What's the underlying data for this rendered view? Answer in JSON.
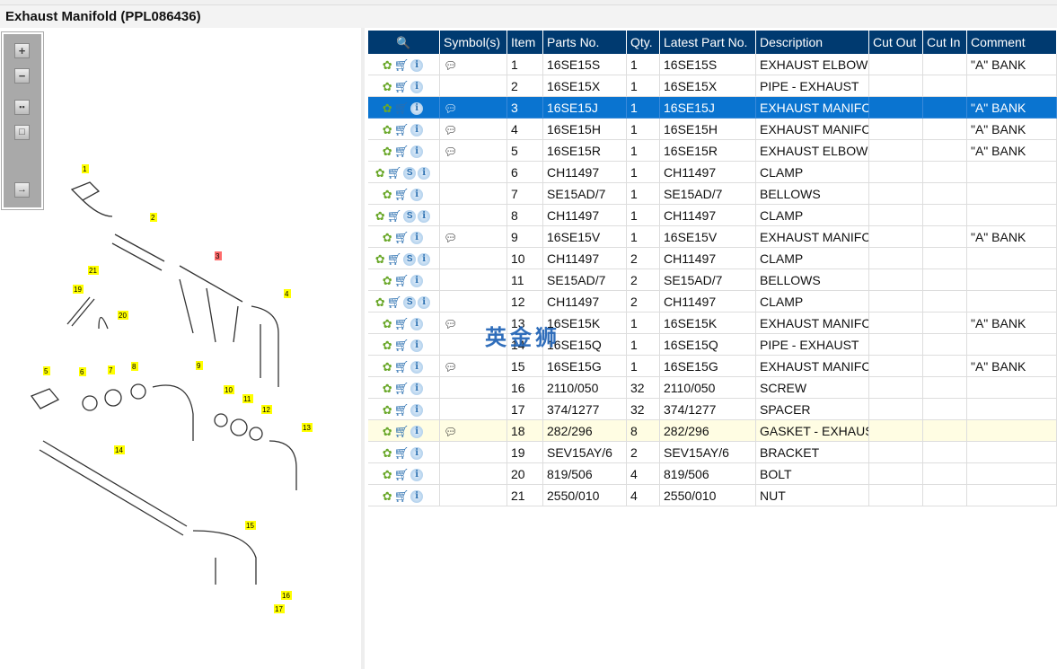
{
  "title": "Exhaust Manifold (PPL086436)",
  "toolbar": [
    "zoom-in",
    "zoom-out",
    "fit-all",
    "fit-window",
    "expand-panel"
  ],
  "columns": [
    "",
    "Symbol(s)",
    "Item",
    "Parts No.",
    "Qty.",
    "Latest Part No.",
    "Description",
    "Cut Out",
    "Cut In",
    "Comment"
  ],
  "rows": [
    {
      "item": "1",
      "part": "16SE15S",
      "qty": "1",
      "latest": "16SE15S",
      "desc": "EXHAUST ELBOW",
      "comment": "\"A\" BANK",
      "sym": true,
      "s": false
    },
    {
      "item": "2",
      "part": "16SE15X",
      "qty": "1",
      "latest": "16SE15X",
      "desc": "PIPE - EXHAUST",
      "comment": "",
      "sym": false,
      "s": false
    },
    {
      "item": "3",
      "part": "16SE15J",
      "qty": "1",
      "latest": "16SE15J",
      "desc": "EXHAUST MANIFC",
      "comment": "\"A\" BANK",
      "sym": true,
      "s": false,
      "selected": true
    },
    {
      "item": "4",
      "part": "16SE15H",
      "qty": "1",
      "latest": "16SE15H",
      "desc": "EXHAUST MANIFC",
      "comment": "\"A\" BANK",
      "sym": true,
      "s": false
    },
    {
      "item": "5",
      "part": "16SE15R",
      "qty": "1",
      "latest": "16SE15R",
      "desc": "EXHAUST ELBOW",
      "comment": "\"A\" BANK",
      "sym": true,
      "s": false
    },
    {
      "item": "6",
      "part": "CH11497",
      "qty": "1",
      "latest": "CH11497",
      "desc": "CLAMP",
      "comment": "",
      "sym": false,
      "s": true
    },
    {
      "item": "7",
      "part": "SE15AD/7",
      "qty": "1",
      "latest": "SE15AD/7",
      "desc": "BELLOWS",
      "comment": "",
      "sym": false,
      "s": false
    },
    {
      "item": "8",
      "part": "CH11497",
      "qty": "1",
      "latest": "CH11497",
      "desc": "CLAMP",
      "comment": "",
      "sym": false,
      "s": true
    },
    {
      "item": "9",
      "part": "16SE15V",
      "qty": "1",
      "latest": "16SE15V",
      "desc": "EXHAUST MANIFC",
      "comment": "\"A\" BANK",
      "sym": true,
      "s": false
    },
    {
      "item": "10",
      "part": "CH11497",
      "qty": "2",
      "latest": "CH11497",
      "desc": "CLAMP",
      "comment": "",
      "sym": false,
      "s": true
    },
    {
      "item": "11",
      "part": "SE15AD/7",
      "qty": "2",
      "latest": "SE15AD/7",
      "desc": "BELLOWS",
      "comment": "",
      "sym": false,
      "s": false
    },
    {
      "item": "12",
      "part": "CH11497",
      "qty": "2",
      "latest": "CH11497",
      "desc": "CLAMP",
      "comment": "",
      "sym": false,
      "s": true
    },
    {
      "item": "13",
      "part": "16SE15K",
      "qty": "1",
      "latest": "16SE15K",
      "desc": "EXHAUST MANIFC",
      "comment": "\"A\" BANK",
      "sym": true,
      "s": false
    },
    {
      "item": "14",
      "part": "16SE15Q",
      "qty": "1",
      "latest": "16SE15Q",
      "desc": "PIPE - EXHAUST",
      "comment": "",
      "sym": false,
      "s": false
    },
    {
      "item": "15",
      "part": "16SE15G",
      "qty": "1",
      "latest": "16SE15G",
      "desc": "EXHAUST MANIFC",
      "comment": "\"A\" BANK",
      "sym": true,
      "s": false
    },
    {
      "item": "16",
      "part": "2110/050",
      "qty": "32",
      "latest": "2110/050",
      "desc": "SCREW",
      "comment": "",
      "sym": false,
      "s": false
    },
    {
      "item": "17",
      "part": "374/1277",
      "qty": "32",
      "latest": "374/1277",
      "desc": "SPACER",
      "comment": "",
      "sym": false,
      "s": false
    },
    {
      "item": "18",
      "part": "282/296",
      "qty": "8",
      "latest": "282/296",
      "desc": "GASKET - EXHAUS",
      "comment": "",
      "sym": true,
      "s": false,
      "highlight": true
    },
    {
      "item": "19",
      "part": "SEV15AY/6",
      "qty": "2",
      "latest": "SEV15AY/6",
      "desc": "BRACKET",
      "comment": "",
      "sym": false,
      "s": false
    },
    {
      "item": "20",
      "part": "819/506",
      "qty": "4",
      "latest": "819/506",
      "desc": "BOLT",
      "comment": "",
      "sym": false,
      "s": false
    },
    {
      "item": "21",
      "part": "2550/010",
      "qty": "4",
      "latest": "2550/010",
      "desc": "NUT",
      "comment": "",
      "sym": false,
      "s": false
    }
  ],
  "callouts": [
    "1",
    "2",
    "3",
    "4",
    "5",
    "6",
    "7",
    "8",
    "9",
    "10",
    "11",
    "12",
    "13",
    "14",
    "15",
    "16",
    "17",
    "19",
    "20",
    "21"
  ],
  "watermark": "英金狮",
  "colors": {
    "header": "#003a70",
    "selected": "#0a74d0",
    "highlight": "#fffde3",
    "callout": "#ffff00",
    "callout_active": "#ff6b6b"
  }
}
